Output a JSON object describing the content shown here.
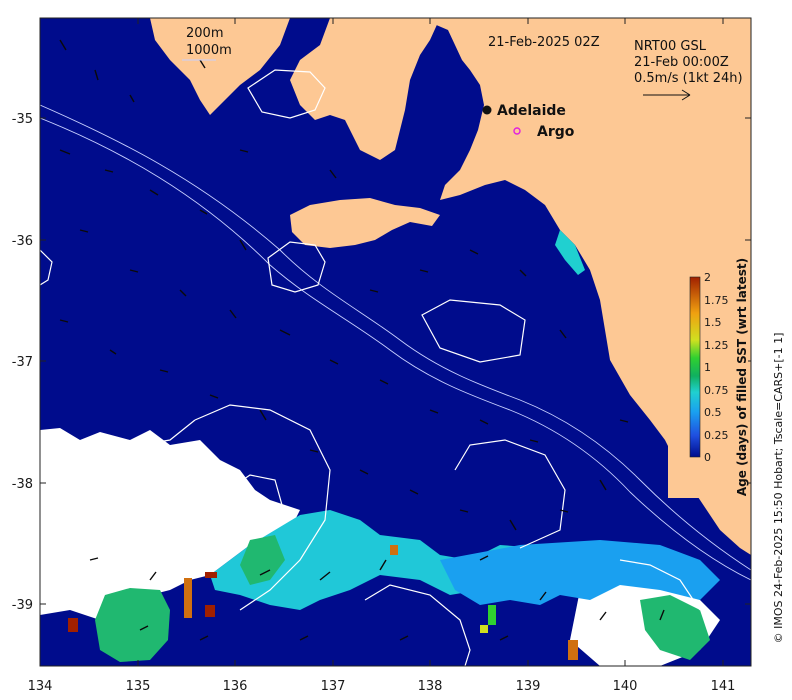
{
  "map": {
    "product_label": "NRT00 GSL",
    "analysis_time": "21-Feb 00:00Z",
    "date_stamp": "21-Feb-2025 02Z",
    "scale_vector_label": "0.5m/s (1kt 24h)",
    "contour_labels": [
      "200m",
      "1000m"
    ],
    "places": [
      {
        "name": "Adelaide",
        "marker": "filled-circle"
      },
      {
        "name": "Argo",
        "marker": "open-circle",
        "color": "#e020e0"
      }
    ],
    "x_ticks": [
      "134",
      "135",
      "136",
      "137",
      "138",
      "139",
      "140",
      "141"
    ],
    "y_ticks": [
      "-35",
      "-36",
      "-37",
      "-38",
      "-39"
    ],
    "colors": {
      "ocean": "#000c8c",
      "land": "#fdc894",
      "no_data": "#ffffff",
      "contour": "#ffffff"
    }
  },
  "colorbar": {
    "title": "Age (days) of filled SST (wrt latest)",
    "ticks": [
      "0",
      "0.25",
      "0.5",
      "0.75",
      "1",
      "1.25",
      "1.5",
      "1.75",
      "2"
    ],
    "min": 0,
    "max": 2,
    "stops": [
      "#000c8c",
      "#1f4fe0",
      "#1aa0f0",
      "#20d0d0",
      "#10b060",
      "#30d030",
      "#d0e020",
      "#f0a010",
      "#a02000"
    ]
  },
  "credit": "© IMOS 24-Feb-2025 15:50 Hobart; Tscale=CARS+[-1 1]"
}
